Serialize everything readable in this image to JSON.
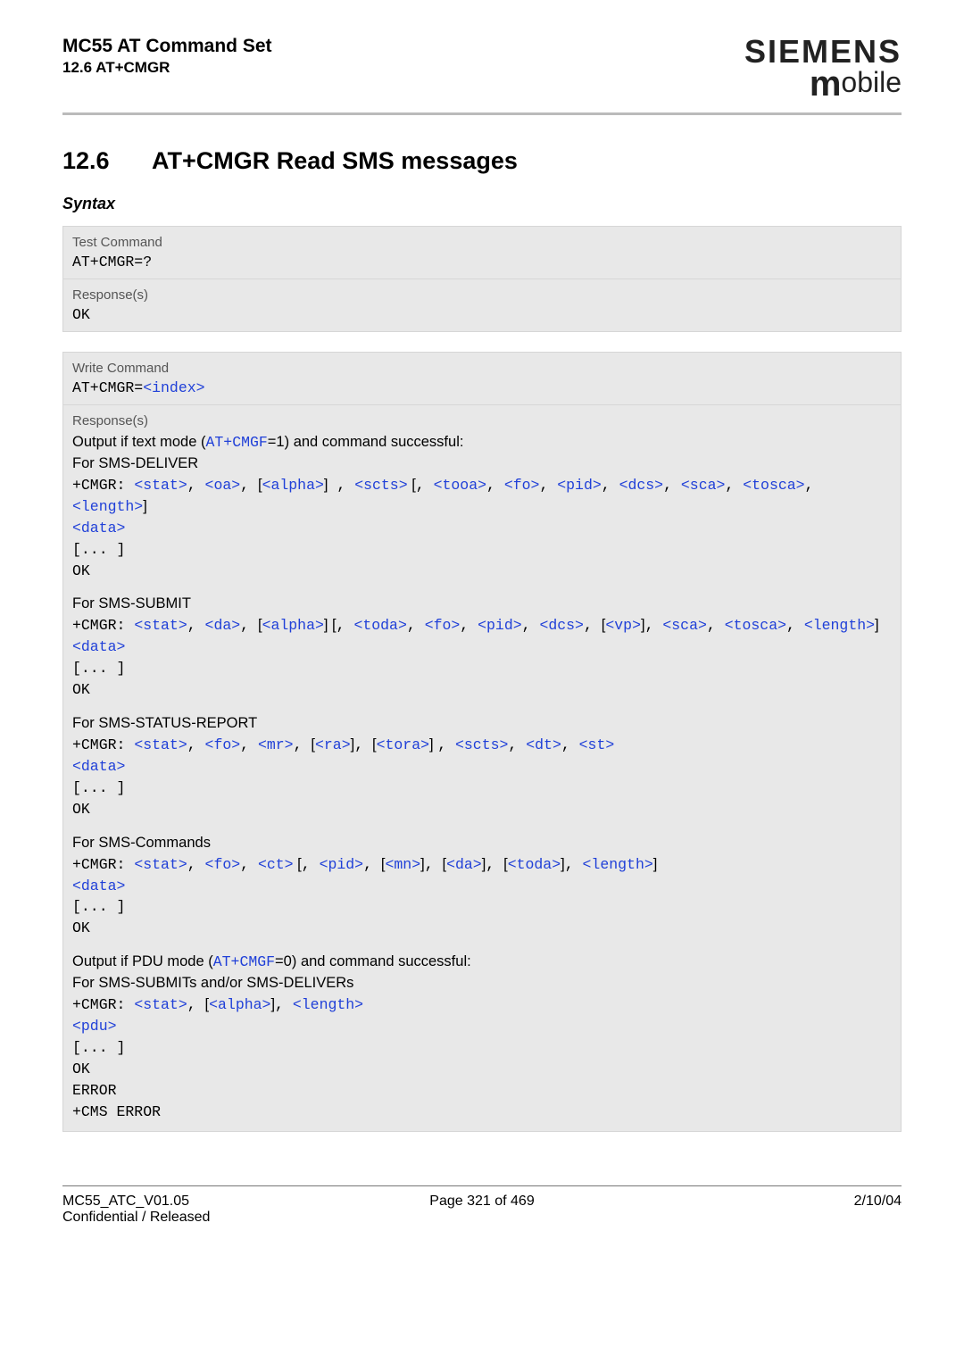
{
  "header": {
    "title": "MC55 AT Command Set",
    "subtitle": "12.6 AT+CMGR",
    "brand": "SIEMENS",
    "brand_sub_m": "m",
    "brand_sub_rest": "obile"
  },
  "section": {
    "num": "12.6",
    "title": "AT+CMGR   Read SMS messages"
  },
  "syntax_label": "Syntax",
  "box1": {
    "label1": "Test Command",
    "cmd1": "AT+CMGR=?",
    "label2": "Response(s)",
    "resp2": "OK"
  },
  "box2": {
    "label1": "Write Command",
    "cmd_prefix": "AT+CMGR=",
    "cmd_param": "<index>",
    "label2": "Response(s)",
    "out_text_pre": "Output if text mode (",
    "at_cmgf": "AT+CMGF",
    "out_text_post1": "=1) and command successful:",
    "for_deliver": "For SMS-DELIVER",
    "cmgr_prefix": "+CMGR: ",
    "p_stat": "<stat>",
    "p_oa": "<oa>",
    "p_alpha": "<alpha>",
    "p_scts": "<scts>",
    "p_tooa": "<tooa>",
    "p_fo": "<fo>",
    "p_pid": "<pid>",
    "p_dcs": "<dcs>",
    "p_sca": "<sca>",
    "p_tosca": "<tosca>",
    "p_length": "<length>",
    "p_data": "<data>",
    "p_dots": "[... ]",
    "p_ok": "OK",
    "for_submit": "For SMS-SUBMIT",
    "p_da": "<da>",
    "p_toda": "<toda>",
    "p_vp": "<vp>",
    "for_status": "For SMS-STATUS-REPORT",
    "p_mr": "<mr>",
    "p_ra": "<ra>",
    "p_tora": "<tora>",
    "p_dt": "<dt>",
    "p_st": "<st>",
    "for_commands": "For SMS-Commands",
    "p_ct": "<ct>",
    "p_mn": "<mn>",
    "out_pdu_pre": "Output if PDU mode (",
    "out_pdu_post": "=0) and command successful:",
    "for_pdu": "For SMS-SUBMITs and/or SMS-DELIVERs",
    "p_pdu": "<pdu>",
    "p_error": "ERROR",
    "p_cms": "+CMS ERROR"
  },
  "punct": {
    "comma": ", ",
    "lbracket": "[",
    "rbracket": "]",
    "space_lbracket": " [",
    "rbracket_space": "] ",
    "comma_space": " , "
  },
  "footer": {
    "left1": "MC55_ATC_V01.05",
    "left2": "Confidential / Released",
    "mid": "Page 321 of 469",
    "right": "2/10/04"
  }
}
